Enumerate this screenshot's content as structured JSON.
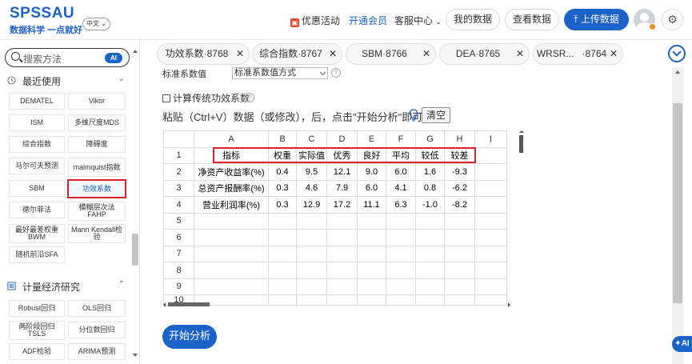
{
  "header": {
    "logo": "SPSSAU",
    "slogan": "数据科学 一点就好",
    "lang": "中文",
    "promo": "优惠活动",
    "vip": "开通会员",
    "service": "客服中心",
    "my_data": "我的数据",
    "view_data": "查看数据",
    "upload": "上传数据"
  },
  "sidebar": {
    "search_placeholder": "搜索方法",
    "ai_label": "AI",
    "recent_title": "最近使用",
    "recent_items": [
      "DEMATEL",
      "Vikor",
      "ISM",
      "多维尺度MDS",
      "综合指数",
      "障碍度",
      "马尔可夫预测",
      "malmquist指数",
      "SBM",
      "功效系数",
      "德尔菲法",
      "模糊层次法FAHP",
      "最好最差权重BWM",
      "Mann Kendall检验",
      "随机前沿SFA"
    ],
    "econ_title": "计量经济研究",
    "econ_items": [
      "Robust回归",
      "OLS回归",
      "两阶段回归TSLS",
      "分位数回归",
      "ADF检验",
      "ARIMA预测"
    ]
  },
  "tabs": [
    {
      "label": "功效系数·8768"
    },
    {
      "label": "综合指数·8767"
    },
    {
      "label": "SBM·8766"
    },
    {
      "label": "DEA·8765"
    },
    {
      "label": "WRSR...   ·8764"
    }
  ],
  "panel": {
    "std_label": "标准系数值",
    "std_select": "标准系数值方式",
    "checkbox_label": "计算传统功效系数",
    "instruction": "粘贴（Ctrl+V）数据（或修改），后，点击\"开始分析\"即可",
    "clear_label": "清空",
    "start_label": "开始分析"
  },
  "grid": {
    "columns": [
      "A",
      "B",
      "C",
      "D",
      "E",
      "F",
      "G",
      "H",
      "I"
    ],
    "row_numbers": [
      "1",
      "2",
      "3",
      "4",
      "5",
      "6",
      "7",
      "8",
      "9",
      "10"
    ],
    "rows": [
      [
        "指标",
        "权重",
        "实际值",
        "优秀",
        "良好",
        "平均",
        "较低",
        "较差",
        ""
      ],
      [
        "净资产收益率(%)",
        "0.4",
        "9.5",
        "12.1",
        "9.0",
        "6.0",
        "1.6",
        "-9.3",
        ""
      ],
      [
        "总资产报酬率(%)",
        "0.3",
        "4.6",
        "7.9",
        "6.0",
        "4.1",
        "0.8",
        "-6.2",
        ""
      ],
      [
        "营业利润率(%)",
        "0.3",
        "12.9",
        "17.2",
        "11.1",
        "6.3",
        "-1.0",
        "-8.2",
        ""
      ]
    ]
  },
  "float_ai": "AI",
  "colors": {
    "brand": "#1b62c9",
    "highlight": "#d9212a"
  }
}
